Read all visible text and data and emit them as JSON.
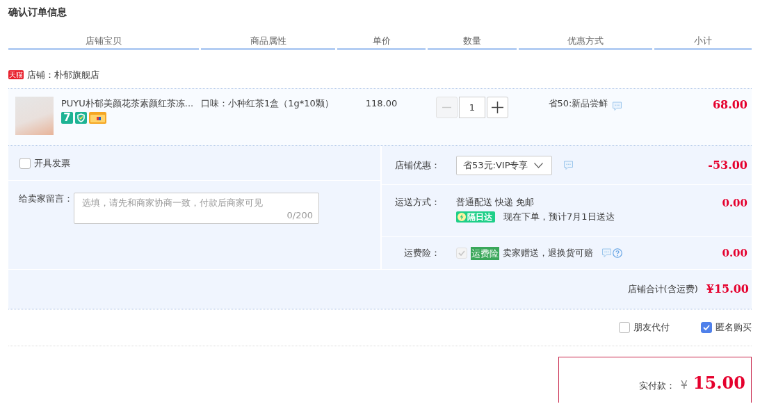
{
  "page": {
    "title": "确认订单信息"
  },
  "columns": [
    "店铺宝贝",
    "商品属性",
    "单价",
    "数量",
    "优惠方式",
    "小计"
  ],
  "shop": {
    "badge": "天猫",
    "name": "店铺：朴郁旗舰店"
  },
  "items": [
    {
      "title": "PUYU朴郁美颜花茶素颜红茶冻...",
      "service_badges": [
        {
          "kind": "number",
          "text": "7"
        },
        {
          "kind": "shield"
        },
        {
          "kind": "card"
        }
      ],
      "attribute": "口味：小种红茶1盒（1g*10颗）",
      "price": "118.00",
      "quantity": "1",
      "decrease_disabled": true,
      "promotion": "省50:新品尝鲜",
      "subtotal": "68.00"
    }
  ],
  "invoice": {
    "label": "开具发票",
    "checked": false
  },
  "message": {
    "label": "给卖家留言：",
    "placeholder": "选填，请先和商家协商一致，付款后商家可见",
    "counter": "0/200"
  },
  "shop_discount": {
    "label": "店铺优惠：",
    "value": "省53元:VIP专享",
    "amount": "-53.00"
  },
  "shipping": {
    "label": "运送方式：",
    "method": "普通配送 快递 免邮",
    "badge": "隔日达",
    "estimate": "现在下单，预计7月1日送达",
    "amount": "0.00"
  },
  "insurance": {
    "label": "运费险：",
    "checked": true,
    "disabled": true,
    "tag": "运费险",
    "note": "卖家赠送，退换货可赔",
    "amount": "0.00"
  },
  "shop_total": {
    "label": "店铺合计(含运费)",
    "amount": "¥15.00"
  },
  "options": [
    {
      "label": "朋友代付",
      "checked": false
    },
    {
      "label": "匿名购买",
      "checked": true
    }
  ],
  "payment": {
    "label": "实付款：",
    "currency": "¥",
    "amount": "15.00"
  }
}
